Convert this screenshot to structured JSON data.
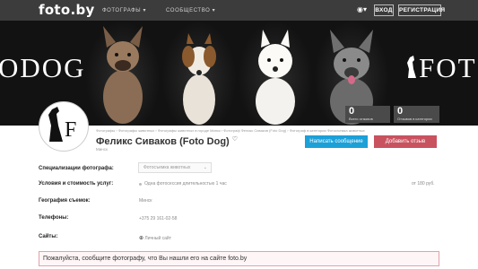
{
  "nav": {
    "logo": "foto.by",
    "photographers": "ФОТОГРАФЫ ▾",
    "community": "СООБЩЕСТВО ▾",
    "login": "ВХОД",
    "register": "РЕГИСТРАЦИЯ"
  },
  "banner": {
    "left_text": "ODOG",
    "right_text": "FOT"
  },
  "stats": [
    {
      "value": "0",
      "label": "Всего отзывов"
    },
    {
      "value": "0",
      "label": "Отзывов в категории"
    }
  ],
  "breadcrumb": "Фотографы › Фотографы животных › Фотографы животных в городе Минск › Фотограф Феликс Сиваков (Foto Dog) › Фотограф в категории Фотосъемка животных",
  "profile": {
    "name": "Феликс Сиваков (Foto Dog)",
    "city": "Минск",
    "message_btn": "Написать сообщение",
    "review_btn": "Добавить отзыв"
  },
  "rows": {
    "spec_label": "Специализации фотографа:",
    "spec_value": "Фотосъемка животных",
    "terms_label": "Условия и стоимость услуг:",
    "terms_value": "Одна фотосессия длительностью 1 час",
    "terms_price": "от 180 руб.",
    "geo_label": "География съемок:",
    "geo_value": "Минск",
    "phones_label": "Телефоны:",
    "phones_value": "+375 29 161-02-58",
    "sites_label": "Сайты:",
    "sites_value": "Личный сайт"
  },
  "notice": "Пожалуйста, сообщите фотографу, что Вы нашли его на сайте foto.by"
}
